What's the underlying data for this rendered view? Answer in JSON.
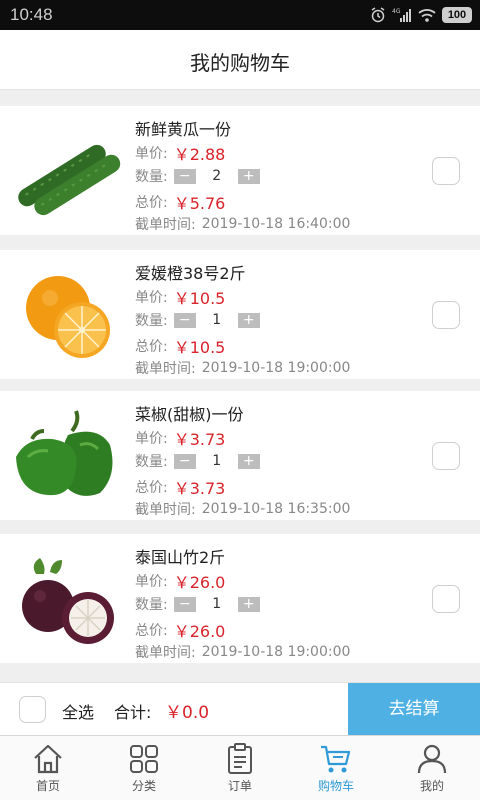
{
  "status_bar": {
    "time": "10:48",
    "network": "4G",
    "battery": "100"
  },
  "header": {
    "title": "我的购物车"
  },
  "labels": {
    "unit_price": "单价:",
    "quantity": "数量:",
    "total": "总价:",
    "deadline": "截单时间:",
    "minus": "−",
    "plus": "+"
  },
  "cart_items": [
    {
      "name": "新鲜黄瓜一份",
      "unit_price": "￥2.88",
      "quantity": "2",
      "total": "￥5.76",
      "deadline": "2019-10-18 16:40:00",
      "image": "cucumber",
      "checked": false
    },
    {
      "name": "爱媛橙38号2斤",
      "unit_price": "￥10.5",
      "quantity": "1",
      "total": "￥10.5",
      "deadline": "2019-10-18 19:00:00",
      "image": "orange",
      "checked": false
    },
    {
      "name": "菜椒(甜椒)一份",
      "unit_price": "￥3.73",
      "quantity": "1",
      "total": "￥3.73",
      "deadline": "2019-10-18 16:35:00",
      "image": "green-pepper",
      "checked": false
    },
    {
      "name": "泰国山竹2斤",
      "unit_price": "￥26.0",
      "quantity": "1",
      "total": "￥26.0",
      "deadline": "2019-10-18 19:00:00",
      "image": "mangosteen",
      "checked": false
    }
  ],
  "bottom_bar": {
    "select_all_label": "全选",
    "total_label": "合计:",
    "total_value": "￥0.0",
    "checkout_label": "去结算"
  },
  "tab_bar": [
    {
      "label": "首页",
      "icon": "home-icon",
      "active": false
    },
    {
      "label": "分类",
      "icon": "category-icon",
      "active": false
    },
    {
      "label": "订单",
      "icon": "order-icon",
      "active": false
    },
    {
      "label": "购物车",
      "icon": "cart-icon",
      "active": true
    },
    {
      "label": "我的",
      "icon": "profile-icon",
      "active": false
    }
  ],
  "colors": {
    "price_red": "#d9232b",
    "checkout_blue": "#4fb0e4",
    "tab_active": "#2f9ad6"
  }
}
